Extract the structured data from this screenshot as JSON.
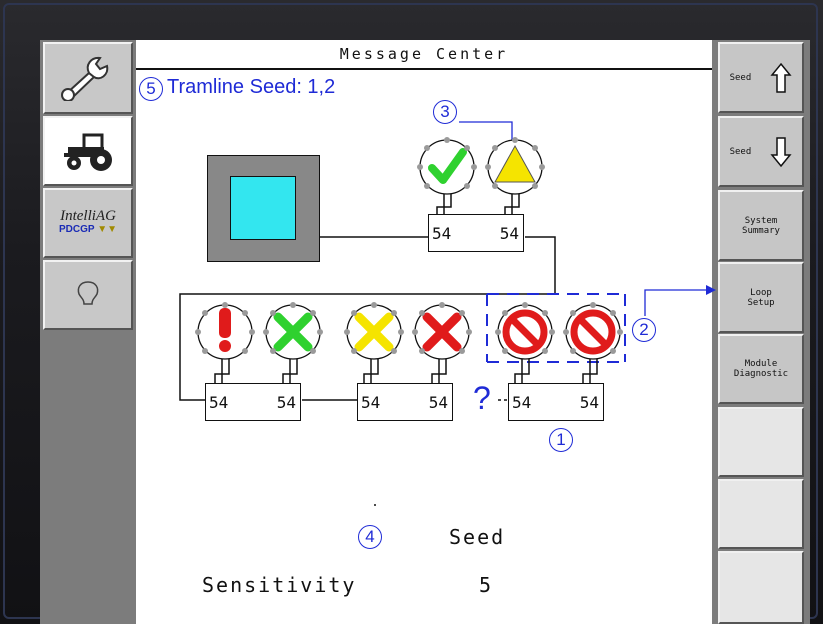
{
  "header": {
    "title": "Message Center"
  },
  "left_sidebar": {
    "items": [
      {
        "icon": "wrench-icon",
        "label": ""
      },
      {
        "icon": "tractor-icon",
        "label": ""
      },
      {
        "icon": "intelliag-logo",
        "label": "",
        "logo_text": "IntelliAG",
        "logo_sub": "PDCGP"
      },
      {
        "icon": "lightbulb-icon",
        "label": ""
      }
    ]
  },
  "right_sidebar": {
    "buttons": [
      {
        "label": "Seed",
        "icon": "arrow-up-icon"
      },
      {
        "label": "Seed",
        "icon": "arrow-down-icon"
      },
      {
        "label": "System\nSummary"
      },
      {
        "label": "Loop\nSetup"
      },
      {
        "label": "Module\nDiagnostic"
      },
      {
        "label": ""
      },
      {
        "label": ""
      },
      {
        "label": ""
      }
    ]
  },
  "annotations": {
    "n1": "1",
    "n2": "2",
    "n3": "3",
    "n4": "4",
    "n5": "5",
    "tramline": "Tramline Seed: 1,2",
    "question": "?"
  },
  "modules": [
    {
      "left": "54",
      "right": "54"
    },
    {
      "left": "54",
      "right": "54"
    },
    {
      "left": "54",
      "right": "54"
    },
    {
      "left": "54",
      "right": "54"
    }
  ],
  "sensors": [
    {
      "state": "ok",
      "icon": "checkmark-icon"
    },
    {
      "state": "warning",
      "icon": "warning-triangle-icon"
    },
    {
      "state": "alert",
      "icon": "exclamation-icon"
    },
    {
      "state": "ok-x",
      "icon": "green-x-icon"
    },
    {
      "state": "caution-x",
      "icon": "yellow-x-icon"
    },
    {
      "state": "error-x",
      "icon": "red-x-icon"
    },
    {
      "state": "disabled",
      "icon": "no-symbol-icon"
    },
    {
      "state": "disabled",
      "icon": "no-symbol-icon"
    }
  ],
  "footer": {
    "mode": "Seed",
    "sensitivity_label": "Sensitivity",
    "sensitivity_value": "5"
  },
  "colors": {
    "annotation_blue": "#1f2bd6",
    "console_cyan": "#33e6ef",
    "ok_green": "#2fd12f",
    "warn_yellow": "#f5e400",
    "error_red": "#e01b1b"
  }
}
